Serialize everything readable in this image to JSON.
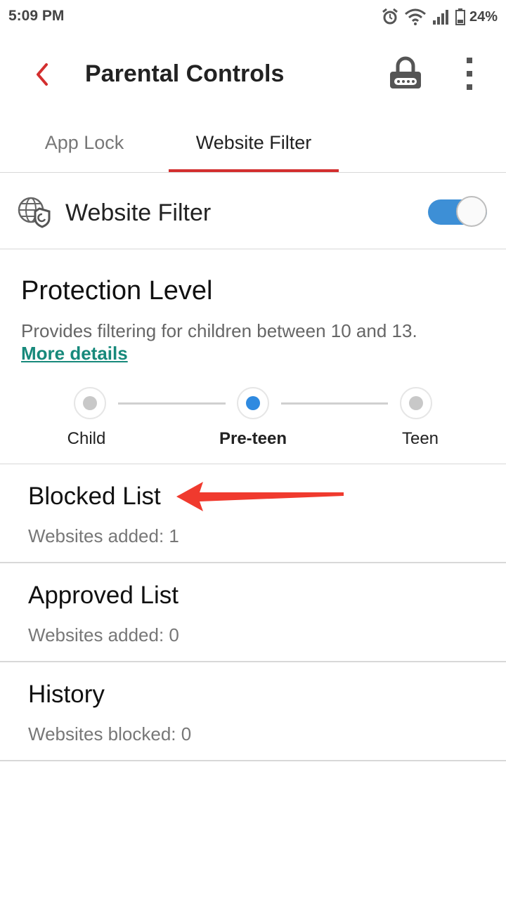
{
  "status_bar": {
    "time": "5:09 PM",
    "battery": "24%",
    "icons": [
      "alarm-icon",
      "wifi-icon",
      "signal-icon",
      "battery-icon"
    ]
  },
  "app_bar": {
    "title": "Parental Controls",
    "back_icon": "chevron-left-icon",
    "lock_icon": "lock-pin-icon",
    "menu_icon": "more-vert-icon",
    "accent_color": "#d32f2f"
  },
  "tabs": [
    {
      "label": "App Lock",
      "selected": false
    },
    {
      "label": "Website Filter",
      "selected": true
    }
  ],
  "website_filter": {
    "label": "Website Filter",
    "enabled": true,
    "toggle_color": "#3d8fd6"
  },
  "protection": {
    "title": "Protection Level",
    "description": "Provides filtering for children between 10 and 13.",
    "link": "More details",
    "link_color": "#17897b",
    "levels": [
      {
        "label": "Child",
        "selected": false
      },
      {
        "label": "Pre-teen",
        "selected": true
      },
      {
        "label": "Teen",
        "selected": false
      }
    ]
  },
  "lists": [
    {
      "title": "Blocked List",
      "subtitle": "Websites added: 1"
    },
    {
      "title": "Approved List",
      "subtitle": "Websites added: 0"
    },
    {
      "title": "History",
      "subtitle": "Websites blocked: 0"
    }
  ],
  "annotation": {
    "arrow_color": "#f03a2e"
  }
}
